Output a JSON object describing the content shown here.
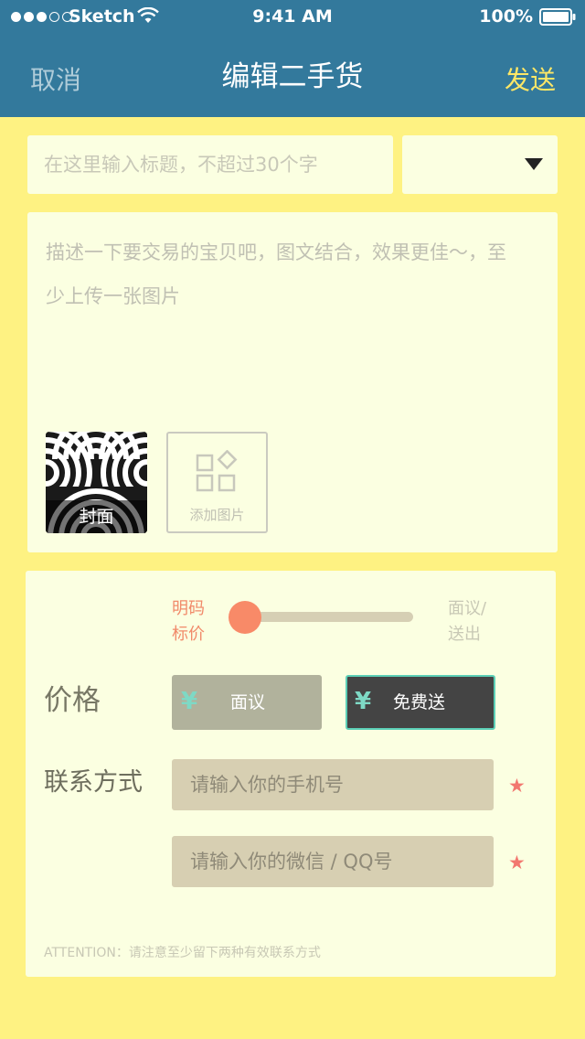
{
  "status_bar": {
    "carrier": "Sketch",
    "time": "9:41 AM",
    "battery": "100%"
  },
  "nav": {
    "cancel": "取消",
    "title": "编辑二手货",
    "send": "发送"
  },
  "form": {
    "title_placeholder": "在这里输入标题，不超过30个字",
    "category_value": "",
    "description_placeholder": "描述一下要交易的宝贝吧，图文结合，效果更佳～，至少上传一张图片",
    "cover_label": "封面",
    "add_photo_label": "添加图片"
  },
  "pricing": {
    "slider_left_label": "明码标价",
    "slider_right_label": "面议/送出",
    "slider_value": 0,
    "price_label": "价格",
    "option_negotiate": "面议",
    "option_free": "免费送",
    "currency_symbol": "¥",
    "selected_option": "免费送"
  },
  "contact": {
    "label": "联系方式",
    "phone_placeholder": "请输入你的手机号",
    "wechat_placeholder": "请输入你的微信 / QQ号",
    "required_mark": "★",
    "attention": "ATTENTION：请注意至少留下两种有效联系方式"
  },
  "colors": {
    "header": "#33799C",
    "background": "#FEF282",
    "card": "#FBFFE1",
    "accent_send": "#FEE766",
    "slider_knob": "#F88A68",
    "required_star": "#F2776F",
    "yen_symbol": "#7ED9C5"
  },
  "icons": {
    "dropdown": "triangle-down-icon",
    "add_photo": "grid-shapes-icon",
    "wifi": "wifi-icon",
    "battery": "battery-icon",
    "required": "star-icon"
  }
}
